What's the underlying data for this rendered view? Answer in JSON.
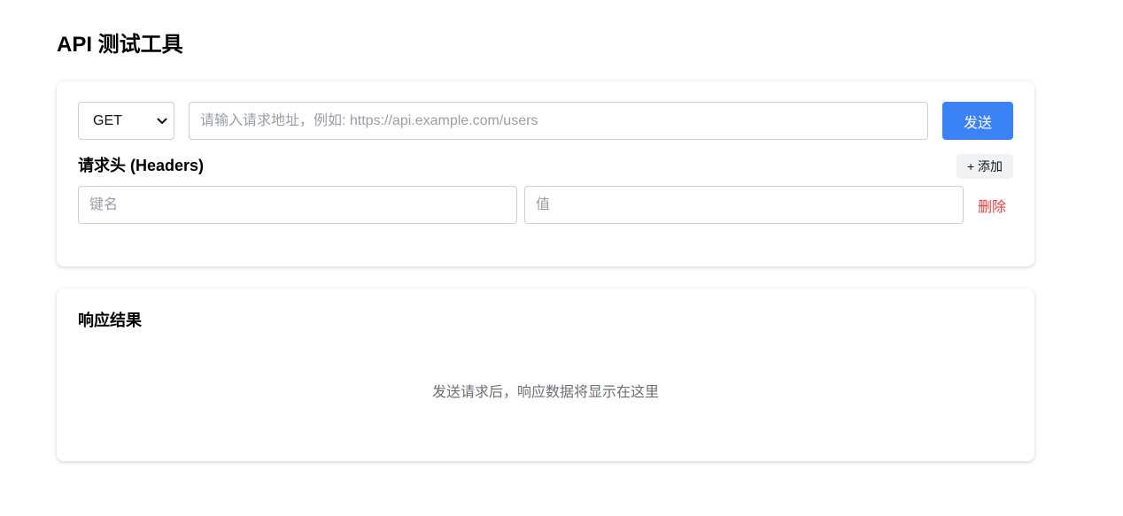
{
  "page": {
    "title": "API 测试工具"
  },
  "request": {
    "method": {
      "selected": "GET",
      "options": [
        "GET"
      ]
    },
    "url": {
      "value": "",
      "placeholder": "请输入请求地址，例如: https://api.example.com/users"
    },
    "send_label": "发送",
    "headers": {
      "heading": "请求头 (Headers)",
      "add_label": "+ 添加",
      "rows": [
        {
          "key_placeholder": "键名",
          "value_placeholder": "值",
          "delete_label": "删除"
        }
      ]
    }
  },
  "response": {
    "heading": "响应结果",
    "empty_text": "发送请求后，响应数据将显示在这里"
  },
  "colors": {
    "accent": "#3b82f6",
    "danger": "#e0413f",
    "muted_text": "#6b6f76"
  },
  "icons": {
    "method_dropdown": "chevron-down-icon"
  }
}
